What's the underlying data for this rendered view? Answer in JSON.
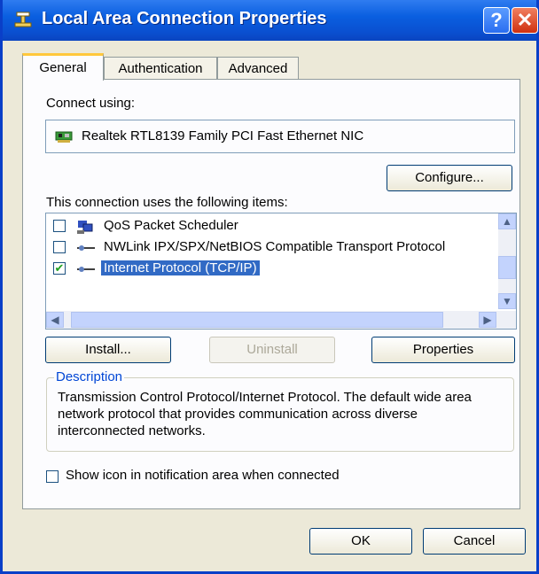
{
  "window": {
    "title": "Local Area Connection Properties",
    "help_glyph": "?",
    "close_glyph": "✕"
  },
  "tabs": [
    {
      "label": "General",
      "active": true
    },
    {
      "label": "Authentication",
      "active": false
    },
    {
      "label": "Advanced",
      "active": false
    }
  ],
  "connect_using": {
    "label": "Connect using:",
    "adapter": "Realtek RTL8139 Family PCI Fast Ethernet NIC"
  },
  "configure_label": "Configure...",
  "components": {
    "label": "This connection uses the following items:",
    "items": [
      {
        "label": "QoS Packet Scheduler",
        "checked": false,
        "selected": false,
        "icon": "scheduler-icon"
      },
      {
        "label": "NWLink IPX/SPX/NetBIOS Compatible Transport Protocol",
        "checked": false,
        "selected": false,
        "icon": "protocol-icon"
      },
      {
        "label": "Internet Protocol (TCP/IP)",
        "checked": true,
        "selected": true,
        "icon": "protocol-icon"
      }
    ]
  },
  "buttons": {
    "install": "Install...",
    "uninstall": "Uninstall",
    "properties": "Properties",
    "ok": "OK",
    "cancel": "Cancel"
  },
  "description": {
    "title": "Description",
    "text": "Transmission Control Protocol/Internet Protocol. The default wide area network protocol that provides communication across diverse interconnected networks."
  },
  "show_icon": {
    "label": "Show icon in notification area when connected",
    "checked": false
  },
  "colors": {
    "titlebar": "#0a5fe0",
    "selection": "#316ac5",
    "group_title": "#0046d5"
  }
}
